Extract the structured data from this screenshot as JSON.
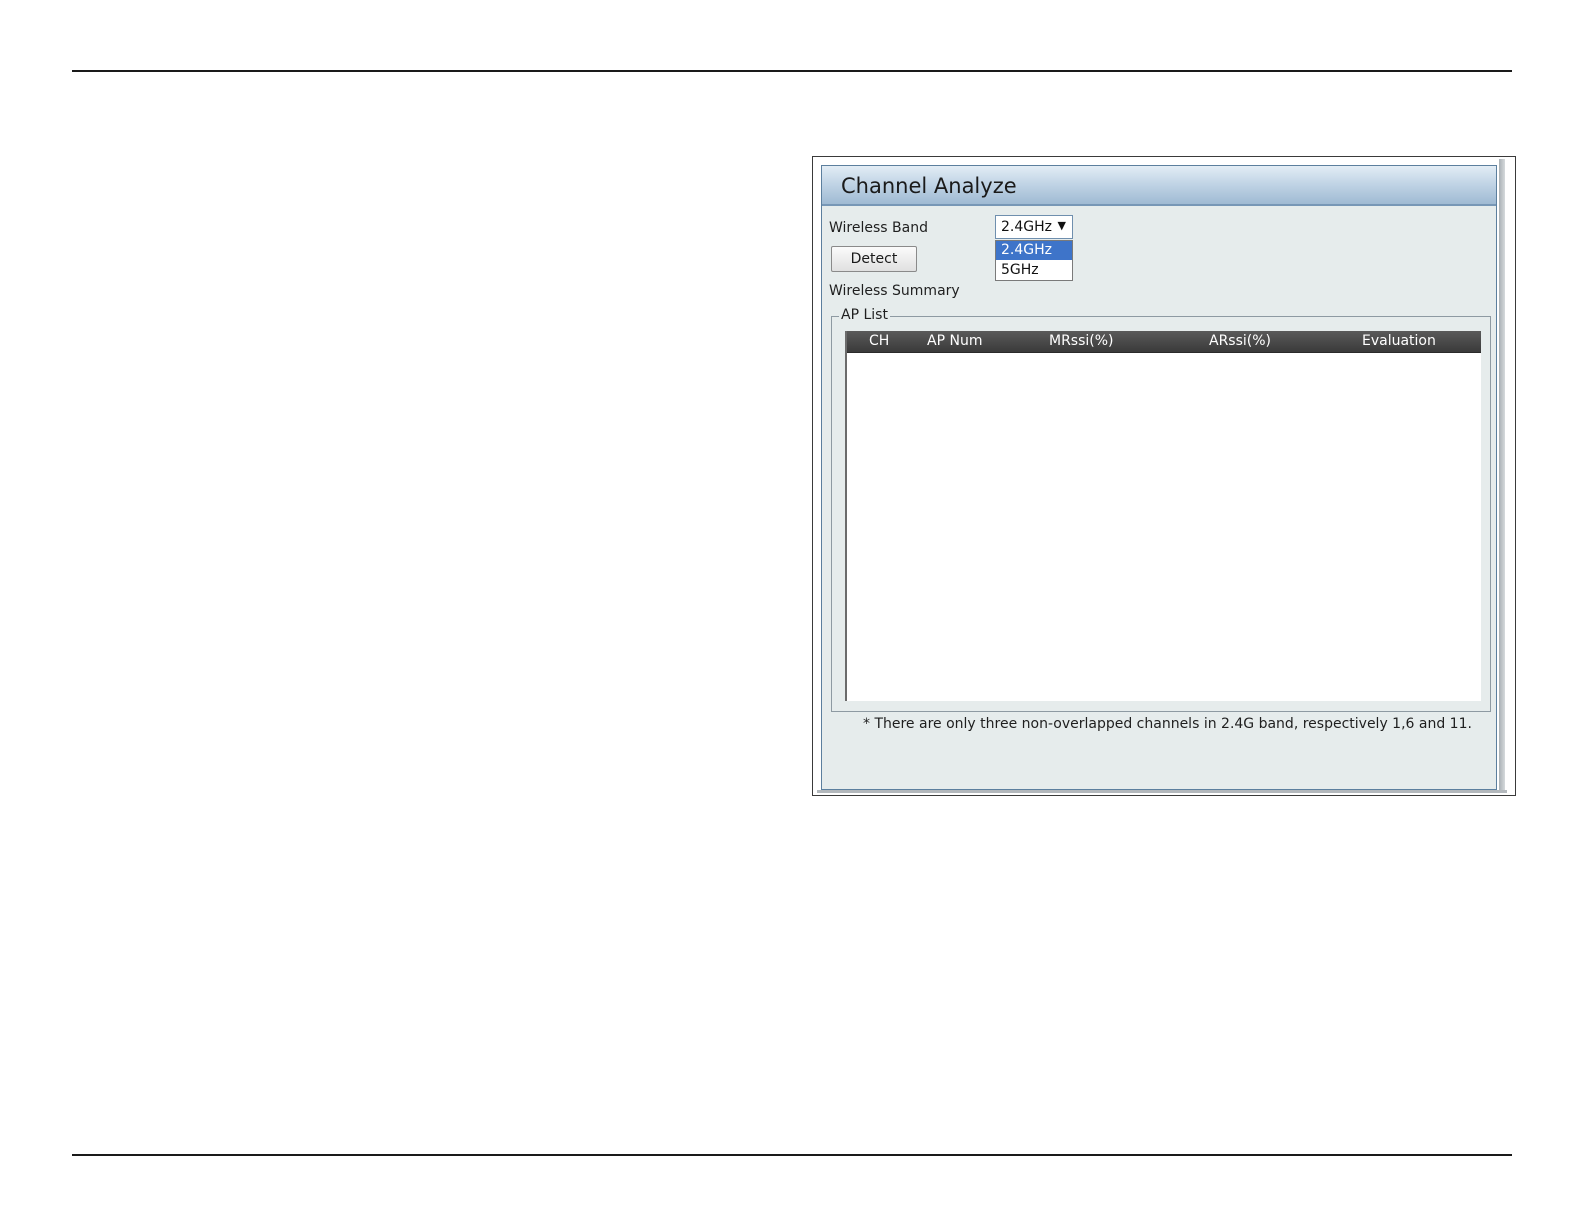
{
  "panel": {
    "title": "Channel Analyze",
    "wireless_band_label": "Wireless Band",
    "band_select": {
      "value": "2.4GHz",
      "options": [
        "2.4GHz",
        "5GHz"
      ],
      "highlighted_option": "2.4GHz"
    },
    "detect_button": "Detect",
    "wireless_summary_label": "Wireless Summary",
    "ap_list": {
      "legend": "AP List",
      "columns": [
        "CH",
        "AP Num",
        "MRssi(%)",
        "ARssi(%)",
        "Evaluation"
      ],
      "rows": []
    },
    "footnote": "* There are only three non-overlapped channels in 2.4G band, respectively 1,6 and 11."
  },
  "colors": {
    "header_gradient_bottom": "#9fbad3",
    "panel_background": "#e6ecec",
    "table_header_background": "#3a3a3a",
    "selected_option_background": "#3e74c9"
  },
  "icons": {
    "select_arrow": "triangle-down-icon"
  }
}
